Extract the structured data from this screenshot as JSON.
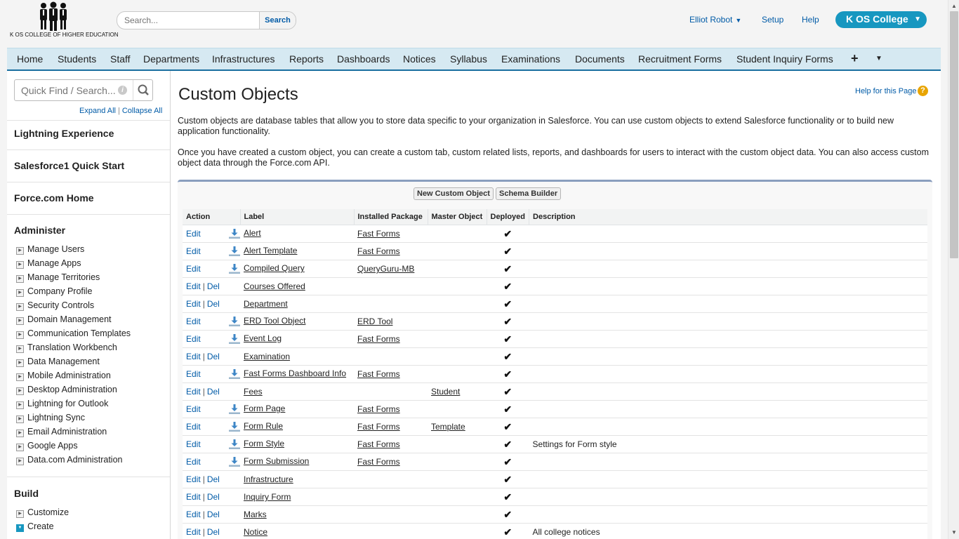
{
  "header": {
    "logo_text": "K OS COLLEGE OF HIGHER EDUCATION",
    "search_placeholder": "Search...",
    "search_button": "Search",
    "user_name": "Elliot Robot",
    "setup": "Setup",
    "help": "Help",
    "app_name": "K OS College"
  },
  "tabs": [
    "Home",
    "Students",
    "Staff",
    "Departments",
    "Infrastructures",
    "Reports",
    "Dashboards",
    "Notices",
    "Syllabus",
    "Examinations",
    "Documents",
    "Recruitment Forms",
    "Student Inquiry Forms"
  ],
  "tab_icons": {
    "add": "+",
    "more": "▼"
  },
  "sidebar": {
    "quick_find_placeholder": "Quick Find / Search...",
    "expand_all": "Expand All",
    "collapse_all": "Collapse All",
    "sections": [
      "Lightning Experience",
      "Salesforce1 Quick Start",
      "Force.com Home",
      "Administer",
      "Build"
    ],
    "administer_items": [
      "Manage Users",
      "Manage Apps",
      "Manage Territories",
      "Company Profile",
      "Security Controls",
      "Domain Management",
      "Communication Templates",
      "Translation Workbench",
      "Data Management",
      "Mobile Administration",
      "Desktop Administration",
      "Lightning for Outlook",
      "Lightning Sync",
      "Email Administration",
      "Google Apps",
      "Data.com Administration"
    ],
    "build_items": [
      "Customize",
      "Create"
    ]
  },
  "main": {
    "title": "Custom Objects",
    "help_link": "Help for this Page",
    "description_1": "Custom objects are database tables that allow you to store data specific to your organization in Salesforce. You can use custom objects to extend Salesforce functionality or to build new application functionality.",
    "description_2": "Once you have created a custom object, you can create a custom tab, custom related lists, reports, and dashboards for users to interact with the custom object data. You can also access custom object data through the Force.com API.",
    "new_button": "New Custom Object",
    "schema_button": "Schema Builder",
    "columns": [
      "Action",
      "Label",
      "Installed Package",
      "Master Object",
      "Deployed",
      "Description"
    ],
    "edit_label": "Edit",
    "del_label": "Del",
    "deployed_mark": "✔",
    "rows": [
      {
        "label": "Alert",
        "package": "Fast Forms",
        "master": "",
        "description": "",
        "del": false,
        "installed": true
      },
      {
        "label": "Alert Template",
        "package": "Fast Forms",
        "master": "",
        "description": "",
        "del": false,
        "installed": true
      },
      {
        "label": "Compiled Query",
        "package": "QueryGuru-MB",
        "master": "",
        "description": "",
        "del": false,
        "installed": true
      },
      {
        "label": "Courses Offered",
        "package": "",
        "master": "",
        "description": "",
        "del": true,
        "installed": false
      },
      {
        "label": "Department",
        "package": "",
        "master": "",
        "description": "",
        "del": true,
        "installed": false
      },
      {
        "label": "ERD Tool Object",
        "package": "ERD Tool",
        "master": "",
        "description": "",
        "del": false,
        "installed": true
      },
      {
        "label": "Event Log",
        "package": "Fast Forms",
        "master": "",
        "description": "",
        "del": false,
        "installed": true
      },
      {
        "label": "Examination",
        "package": "",
        "master": "",
        "description": "",
        "del": true,
        "installed": false
      },
      {
        "label": "Fast Forms Dashboard Info",
        "package": "Fast Forms",
        "master": "",
        "description": "",
        "del": false,
        "installed": true
      },
      {
        "label": "Fees",
        "package": "",
        "master": "Student",
        "description": "",
        "del": true,
        "installed": false
      },
      {
        "label": "Form Page",
        "package": "Fast Forms",
        "master": "",
        "description": "",
        "del": false,
        "installed": true
      },
      {
        "label": "Form Rule",
        "package": "Fast Forms",
        "master": "Template",
        "description": "",
        "del": false,
        "installed": true
      },
      {
        "label": "Form Style",
        "package": "Fast Forms",
        "master": "",
        "description": "Settings for Form style",
        "del": false,
        "installed": true
      },
      {
        "label": "Form Submission",
        "package": "Fast Forms",
        "master": "",
        "description": "",
        "del": false,
        "installed": true
      },
      {
        "label": "Infrastructure",
        "package": "",
        "master": "",
        "description": "",
        "del": true,
        "installed": false
      },
      {
        "label": "Inquiry Form",
        "package": "",
        "master": "",
        "description": "",
        "del": true,
        "installed": false
      },
      {
        "label": "Marks",
        "package": "",
        "master": "",
        "description": "",
        "del": true,
        "installed": false
      },
      {
        "label": "Notice",
        "package": "",
        "master": "",
        "description": "All college notices",
        "del": true,
        "installed": false
      }
    ]
  },
  "colors": {
    "brand": "#1797c0",
    "link": "#015ba7",
    "tab_bar": "#d6e9f2",
    "tab_border": "#1a6fa0"
  }
}
